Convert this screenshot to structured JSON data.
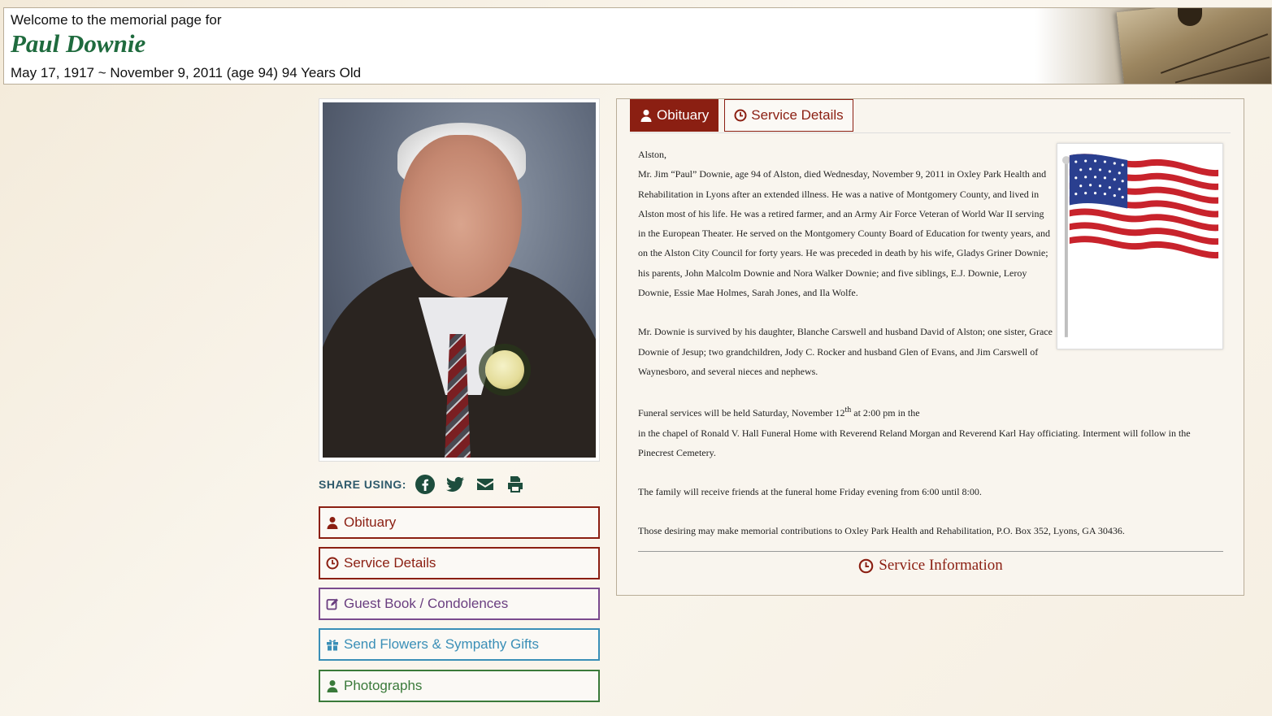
{
  "header": {
    "welcome": "Welcome to the memorial page for",
    "name": "Paul Downie",
    "dates": "May 17, 1917 ~ November 9, 2011 (age 94) 94 Years Old"
  },
  "share": {
    "label": "SHARE USING:",
    "icons": [
      "facebook-icon",
      "twitter-icon",
      "envelope-icon",
      "print-icon"
    ]
  },
  "nav": {
    "obituary": "Obituary",
    "service_details": "Service Details",
    "guest_book": "Guest Book / Condolences",
    "flowers": "Send Flowers & Sympathy Gifts",
    "photographs": "Photographs"
  },
  "tabs": {
    "obituary": "Obituary",
    "service_details": "Service Details"
  },
  "obituary": {
    "p1": "Alston,",
    "p2": "Mr. Jim “Paul” Downie, age 94 of Alston, died Wednesday, November 9, 2011 in Oxley Park Health and Rehabilitation in Lyons after an extended illness. He was a native of Montgomery County, and lived in Alston most of his life. He was a retired farmer, and an Army Air Force Veteran of World War II serving in the European Theater. He served on the Montgomery County Board of Education for twenty years, and on the Alston City Council for forty years. He was preceded in death by his wife, Gladys Griner Downie; his parents, John Malcolm Downie and Nora Walker Downie; and five siblings, E.J. Downie, Leroy Downie, Essie Mae Holmes, Sarah Jones, and Ila Wolfe.",
    "p3": "Mr. Downie is survived by his daughter, Blanche Carswell and husband David of Alston; one sister, Grace Downie of Jesup; two grandchildren, Jody C. Rocker and husband Glen of Evans, and Jim Carswell of Waynesboro, and several nieces and nephews.",
    "p4a": "Funeral services will be held Saturday, November 12",
    "p4sup": "th",
    "p4b": " at 2:00 pm in the",
    "p4c": "in the chapel of Ronald V. Hall Funeral Home with Reverend Reland Morgan and Reverend Karl Hay officiating. Interment will follow in the Pinecrest Cemetery.",
    "p5": "The family will receive friends at the funeral home Friday evening from 6:00 until 8:00.",
    "p6": "Those desiring may make memorial contributions to Oxley Park Health and Rehabilitation, P.O. Box 352, Lyons, GA 30436."
  },
  "service_info": "Service Information",
  "colors": {
    "accent": "#8b1f12",
    "name_green": "#1f6b3e",
    "guest_purple": "#6a3e80",
    "flowers_blue": "#3a8fb7",
    "photos_green": "#3a7a3a"
  }
}
